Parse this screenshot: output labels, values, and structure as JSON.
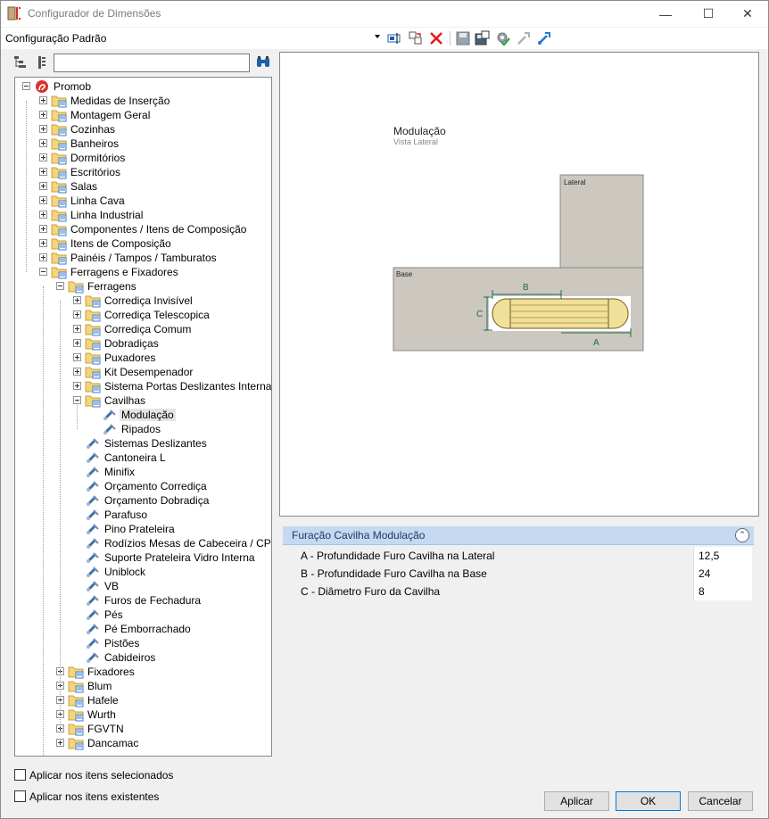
{
  "window": {
    "title": "Configurador de Dimensões",
    "minimize": "—",
    "maximize": "☐",
    "close": "✕"
  },
  "toolbar": {
    "config_name": "Configuração Padrão"
  },
  "search": {
    "value": "",
    "placeholder": ""
  },
  "tree": {
    "root": "Promob",
    "level1": [
      "Medidas de Inserção",
      "Montagem Geral",
      "Cozinhas",
      "Banheiros",
      "Dormitórios",
      "Escritórios",
      "Salas",
      "Linha Cava",
      "Linha Industrial",
      "Componentes / Itens de Composição",
      "Itens de Composição",
      "Painéis / Tampos / Tamburatos",
      "Ferragens e Fixadores"
    ],
    "ferragens": "Ferragens",
    "ferragens_children": [
      "Corrediça Invisível",
      "Corrediça Telescopica",
      "Corrediça Comum",
      "Dobradiças",
      "Puxadores",
      "Kit Desempenador",
      "Sistema Portas Deslizantes Internas",
      "Cavilhas"
    ],
    "cavilhas_children": [
      "Modulação",
      "Ripados"
    ],
    "ferragens_leaves": [
      "Sistemas Deslizantes",
      "Cantoneira L",
      "Minifix",
      "Orçamento Corrediça",
      "Orçamento Dobradiça",
      "Parafuso",
      "Pino Prateleira",
      "Rodízios Mesas de Cabeceira / CPU",
      "Suporte Prateleira Vidro Interna",
      "Uniblock",
      "VB",
      "Furos de Fechadura",
      "Pés",
      "Pé Emborrachado",
      "Pistões",
      "Cabideiros"
    ],
    "fixadores_siblings": [
      "Fixadores",
      "Blum",
      "Hafele",
      "Wurth",
      "FGVTN",
      "Dancamac"
    ]
  },
  "preview": {
    "title": "Modulação",
    "subtitle": "Vista Lateral",
    "label_lateral": "Lateral",
    "label_base": "Base",
    "dim_a": "A",
    "dim_b": "B",
    "dim_c": "C"
  },
  "properties": {
    "header": "Furação Cavilha Modulação",
    "rows": [
      {
        "name": "A - Profundidade Furo Cavilha na Lateral",
        "value": "12,5"
      },
      {
        "name": "B - Profundidade Furo Cavilha na Base",
        "value": "24"
      },
      {
        "name": "C - Diâmetro Furo da Cavilha",
        "value": "8"
      }
    ]
  },
  "options": {
    "apply_selected": "Aplicar nos itens selecionados",
    "apply_existing": "Aplicar nos itens existentes"
  },
  "buttons": {
    "apply": "Aplicar",
    "ok": "OK",
    "cancel": "Cancelar"
  }
}
